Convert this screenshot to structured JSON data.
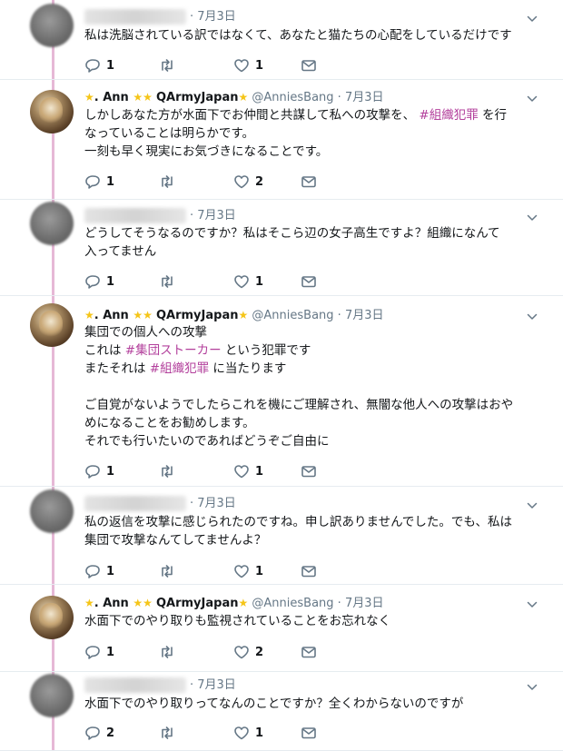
{
  "author": {
    "name_text": ". Ann ",
    "brand_text": "QArmyJapan",
    "handle": "@AnniesBang"
  },
  "tweets": [
    {
      "type": "other",
      "date": "7月3日",
      "segs": [
        {
          "t": "私は洗脳されている訳ではなくて、あなたと猫たちの心配をしているだけです"
        }
      ],
      "reply": "1",
      "rt": "",
      "like": "1"
    },
    {
      "type": "ann",
      "date": "7月3日",
      "segs": [
        {
          "t": "しかしあなた方が水面下でお仲間と共謀して私への攻撃を、 "
        },
        {
          "t": "#組織犯罪",
          "tag": true
        },
        {
          "t": " を行\nなっていることは明らかです。\n一刻も早く現実にお気づきになることです。"
        }
      ],
      "reply": "1",
      "rt": "",
      "like": "2"
    },
    {
      "type": "other",
      "date": "7月3日",
      "segs": [
        {
          "t": "どうしてそうなるのですか？私はそこら辺の女子高生ですよ？組織になんて\n入ってません"
        }
      ],
      "reply": "1",
      "rt": "",
      "like": "1"
    },
    {
      "type": "ann",
      "date": "7月3日",
      "segs": [
        {
          "t": "集団での個人への攻撃\nこれは "
        },
        {
          "t": "#集団ストーカー",
          "tag": true
        },
        {
          "t": " という犯罪です\nまたそれは "
        },
        {
          "t": "#組織犯罪",
          "tag": true
        },
        {
          "t": " に当たります\n\nご自覚がないようでしたらこれを機にご理解され、無闇な他人への攻撃はおや\nめになることをお勧めします。\nそれでも行いたいのであればどうぞご自由に"
        }
      ],
      "reply": "1",
      "rt": "",
      "like": "1"
    },
    {
      "type": "other",
      "date": "7月3日",
      "segs": [
        {
          "t": "私の返信を攻撃に感じられたのですね。申し訳ありませんでした。でも、私は\n集団で攻撃なんてしてませんよ？"
        }
      ],
      "reply": "1",
      "rt": "",
      "like": "1"
    },
    {
      "type": "ann",
      "date": "7月3日",
      "segs": [
        {
          "t": "水面下でのやり取りも監視されていることをお忘れなく"
        }
      ],
      "reply": "1",
      "rt": "",
      "like": "2"
    },
    {
      "type": "other",
      "date": "7月3日",
      "segs": [
        {
          "t": "水面下でのやり取りってなんのことですか？全くわからないのですが"
        }
      ],
      "reply": "2",
      "rt": "",
      "like": "1"
    }
  ]
}
